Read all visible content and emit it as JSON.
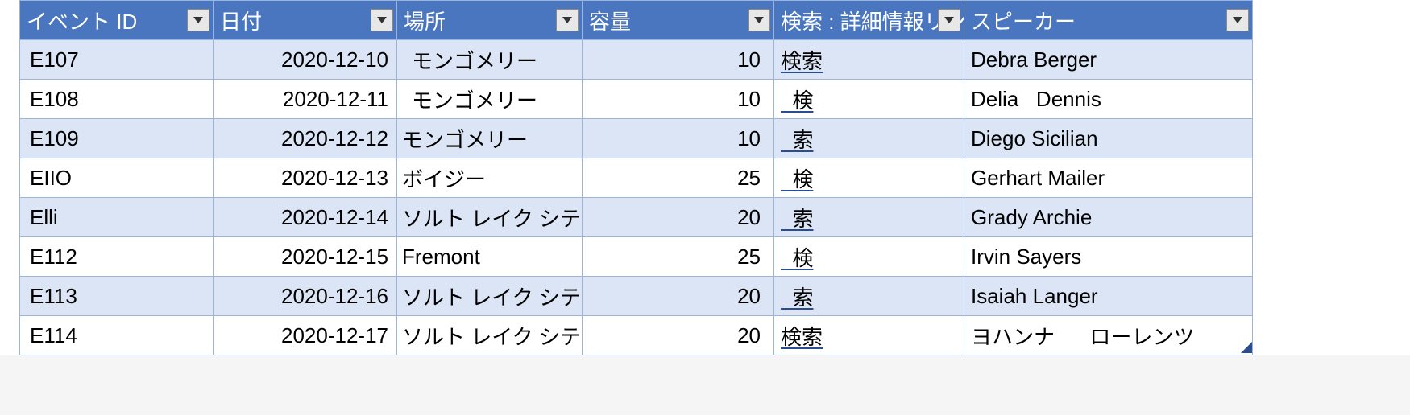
{
  "headers": {
    "id": "イベント ID",
    "date": "日付",
    "location": "場所",
    "capacity": "容量",
    "link": "検索 : 詳細情報リンク",
    "speaker": "スピーカー"
  },
  "rows": [
    {
      "id": "E107",
      "date": "2020-12-10",
      "location": "モンゴメリー",
      "loc_pad": "wide",
      "capacity": "10",
      "link": "検索",
      "speaker": "Debra Berger"
    },
    {
      "id": "E108",
      "date": "2020-12-11",
      "location": "モンゴメリー",
      "loc_pad": "wide",
      "capacity": "10",
      "link": "  検",
      "speaker": "Delia   Dennis"
    },
    {
      "id": "E109",
      "date": "2020-12-12",
      "location": "モンゴメリー",
      "loc_pad": "",
      "capacity": "10",
      "link": "  索",
      "speaker": "Diego Sicilian"
    },
    {
      "id": "EIIO",
      "date": "2020-12-13",
      "location": "ボイジー",
      "loc_pad": "",
      "capacity": "25",
      "link": "  検",
      "speaker": "Gerhart Mailer"
    },
    {
      "id": "Elli",
      "date": "2020-12-14",
      "location": "ソルト レイク シティ",
      "loc_pad": "",
      "capacity": "20",
      "link": "  索",
      "speaker": "Grady Archie"
    },
    {
      "id": "E112",
      "date": "2020-12-15",
      "location": "Fremont",
      "loc_pad": "",
      "capacity": "25",
      "link": "  検",
      "speaker": "Irvin Sayers"
    },
    {
      "id": "E113",
      "date": "2020-12-16",
      "location": "ソルト レイク シティ",
      "loc_pad": "",
      "capacity": "20",
      "link": "  索",
      "speaker": "Isaiah Langer"
    },
    {
      "id": "E114",
      "date": "2020-12-17",
      "location": "ソルト レイク シティ",
      "loc_pad": "",
      "capacity": "20",
      "link": "検索",
      "speaker": "ヨハンナ      ローレンツ"
    }
  ]
}
